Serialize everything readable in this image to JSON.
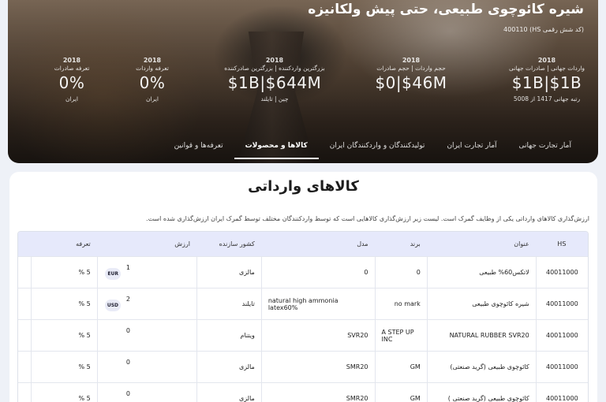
{
  "hero": {
    "title": "شیره کائوچوی طبیعی، حتی پیش ولکانیزه",
    "hs_line": "(کد شش رقمی HS) 400110",
    "stats": [
      {
        "year": "2018",
        "label": "واردات جهانی | صادرات جهانی",
        "value": "$1B|$1B",
        "sub": "رتبه جهانی 1417 از 5008"
      },
      {
        "year": "2018",
        "label": "حجم واردات | حجم صادرات",
        "value": "$0|$46M",
        "sub": ""
      },
      {
        "year": "2018",
        "label": "بزرگترین واردکننده | بزرگترین صادرکننده",
        "value": "$1B|$644M",
        "sub": "چین | تایلند"
      },
      {
        "year": "2018",
        "label": "تعرفه واردات",
        "value": "0%",
        "sub": "ایران"
      },
      {
        "year": "2018",
        "label": "تعرفه صادرات",
        "value": "0%",
        "sub": "ایران"
      }
    ],
    "tabs": [
      {
        "label": "آمار تجارت جهانی",
        "active": false
      },
      {
        "label": "آمار تجارت ایران",
        "active": false
      },
      {
        "label": "تولیدکنندگان و واردکنندگان ایران",
        "active": false
      },
      {
        "label": "کالاها و محصولات",
        "active": true
      },
      {
        "label": "تعرفه‌ها و قوانین",
        "active": false
      }
    ]
  },
  "main": {
    "title": "کالاهای وارداتی",
    "description": "ارزش‌گذاری کالاهای وارداتی یکی از وظایف گمرک است. لیست زیر ارزش‌گذاری کالاهایی است که توسط واردکنندگان مختلف توسط گمرک ایران ارزش‌گذاری شده است.",
    "columns": {
      "hs": "HS",
      "title": "عنوان",
      "brand": "برند",
      "model": "مدل",
      "country": "کشور سازنده",
      "value": "ارزش",
      "tariff": "تعرفه"
    },
    "rows": [
      {
        "hs": "40011000",
        "title": "لاتکس60% طبیعی",
        "brand": "0",
        "model": "0",
        "country": "مالزی",
        "value": "1",
        "currency": "EUR",
        "tariff": "5 %"
      },
      {
        "hs": "40011000",
        "title": "شیره کائوچوی طبیعی",
        "brand": "no mark",
        "model": "natural high ammonia latex60%",
        "country": "تایلند",
        "value": "2",
        "currency": "USD",
        "tariff": "5 %"
      },
      {
        "hs": "40011000",
        "title": "NATURAL RUBBER SVR20",
        "brand": "A STEP UP INC",
        "model": "SVR20",
        "country": "ویتنام",
        "value": "0",
        "currency": "",
        "tariff": "5 %"
      },
      {
        "hs": "40011000",
        "title": "کائوچوی طبیعی (گرید صنعتی)",
        "brand": "GM",
        "model": "SMR20",
        "country": "مالزی",
        "value": "0",
        "currency": "",
        "tariff": "5 %"
      },
      {
        "hs": "40011000",
        "title": "کائوچوی طبیعی (گرید صنعتی )",
        "brand": "GM",
        "model": "SMR20",
        "country": "مالزی",
        "value": "0",
        "currency": "",
        "tariff": "5 %"
      }
    ]
  }
}
